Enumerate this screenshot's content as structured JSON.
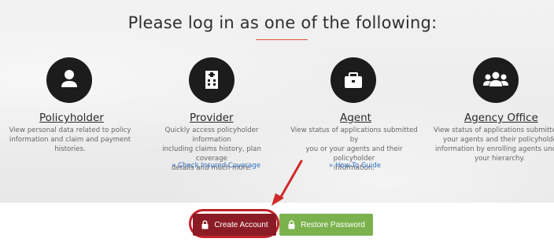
{
  "heading": "Please log in as one of the following:",
  "colors": {
    "accent": "#e1563a",
    "create": "#8b1c25",
    "restore": "#7bb24e",
    "arrow": "#d02a2a",
    "link": "#2f6fbf"
  },
  "options": [
    {
      "name": "Policyholder",
      "icon": "person-icon",
      "desc": [
        "View personal data related to policy",
        "information and claim and payment",
        "histories."
      ],
      "link": ""
    },
    {
      "name": "Provider",
      "icon": "hospital-icon",
      "desc": [
        "Quickly access policyholder information",
        "including claims history, plan coverage",
        "details and much more."
      ],
      "link": "» Check Insured Coverage"
    },
    {
      "name": "Agent",
      "icon": "briefcase-icon",
      "desc": [
        "View status of applications submitted by",
        "you or your agents and their policyholder",
        "information."
      ],
      "link": "» How-To Guide"
    },
    {
      "name": "Agency Office",
      "icon": "group-icon",
      "desc": [
        "View status of applications submitted b",
        "your agents and their policyholder",
        "information by enrolling agents under",
        "your hierarchy."
      ],
      "link": ""
    }
  ],
  "buttons": {
    "create": "Create Account",
    "restore": "Restore Password"
  }
}
